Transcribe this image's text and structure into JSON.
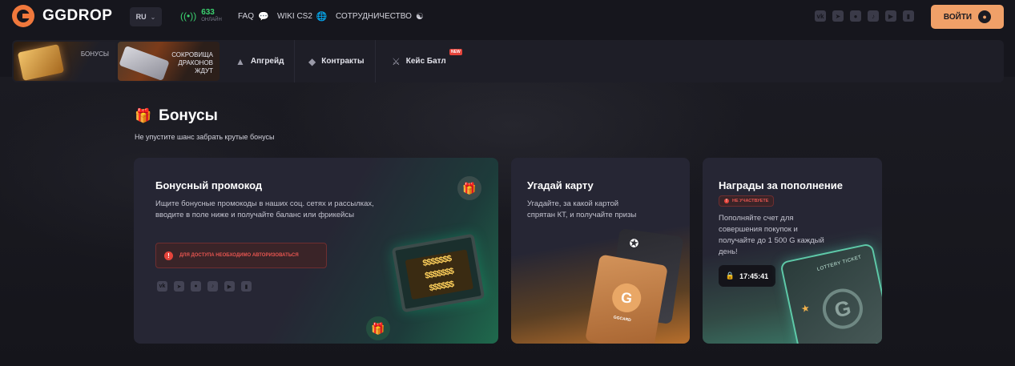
{
  "header": {
    "brand": "GGDROP",
    "lang": "RU",
    "online_count": "633",
    "online_label": "онлайн",
    "links": [
      {
        "label": "FAQ",
        "icon": "chat-icon"
      },
      {
        "label": "WIKI CS2",
        "icon": "globe-icon"
      },
      {
        "label": "СОТРУДНИЧЕСТВО",
        "icon": "partnership-icon"
      }
    ],
    "socials": [
      "vk",
      "telegram",
      "discord",
      "tiktok",
      "youtube",
      "twitch"
    ],
    "login_label": "ВОЙТИ"
  },
  "subnav": {
    "promos": [
      {
        "label": "БОНУСЫ"
      },
      {
        "label": "СОКРОВИЩА ДРАКОНОВ ЖДУТ"
      }
    ],
    "items": [
      {
        "label": "Апгрейд",
        "icon": "upgrade-icon"
      },
      {
        "label": "Контракты",
        "icon": "contract-icon"
      },
      {
        "label": "Кейс Батл",
        "icon": "battle-icon",
        "badge": "NEW"
      }
    ]
  },
  "page": {
    "title": "Бонусы",
    "subtitle": "Не упустите шанс забрать крутые бонусы"
  },
  "cards": {
    "promo": {
      "title": "Бонусный промокод",
      "text": "Ищите бонусные промокоды в наших соц. сетях и рассылках, вводите в поле ниже и получайте баланс или фрикейсы",
      "alert": "Для доступа необходимо авторизоваться",
      "screen_text": "$$$$$$$\n$$$$$$$\n$$$$$$"
    },
    "guess": {
      "title": "Угадай карту",
      "text": "Угадайте, за какой картой спрятан КТ, и получайте призы",
      "card_label": "GGCARD"
    },
    "deposit": {
      "title": "Награды за пополнение",
      "badge": "не участвуете",
      "text": "Пополняйте счет для совершения покупок и получайте до 1 500 G каждый день!",
      "timer": "17:45:41",
      "art_label": "LOTTERY TICKET"
    }
  },
  "colors": {
    "accent": "#f0a068",
    "brand_orange": "#f0783c",
    "online_green": "#3bd16f",
    "alert_red": "#e5443b"
  }
}
